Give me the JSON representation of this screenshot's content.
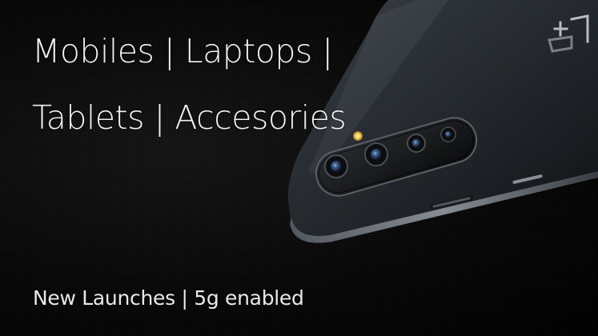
{
  "banner": {
    "headline_line_1": "Mobiles | Laptops |",
    "headline_line_2": "Tablets | Accesories",
    "tagline": "New Launches | 5g enabled"
  },
  "colors": {
    "background": "#000000",
    "text": "#f2f2f2",
    "phone_body": "#2b3036",
    "camera_lens": "#3d5d8a",
    "flash": "#f2c14e"
  },
  "icons": {
    "brand_logo": "oneplus-logo-icon"
  }
}
